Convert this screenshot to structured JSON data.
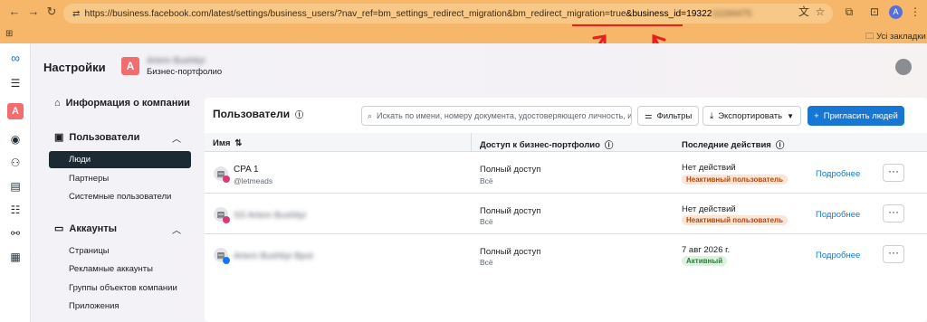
{
  "browser": {
    "url_prefix": "https://business.facebook.com/latest/settings/business_users/?nav_ref=bm_settings_redirect_migration&bm_redirect_migration=true",
    "url_highlight": "&business_id=19322",
    "url_blurred": "11194475",
    "bookmarks_label": "Усі закладки",
    "profile_letter": "A"
  },
  "header": {
    "title": "Настройки",
    "business_logo_letter": "A",
    "business_name": "Artem Bushtiyi",
    "business_subtitle": "Бизнес-портфолио"
  },
  "sidebar": {
    "company_info": "Информация о компании",
    "users_section": "Пользователи",
    "users_items": [
      "Люди",
      "Партнеры",
      "Системные пользователи"
    ],
    "accounts_section": "Аккаунты",
    "accounts_items": [
      "Страницы",
      "Рекламные аккаунты",
      "Группы объектов компании",
      "Приложения"
    ]
  },
  "panel": {
    "title": "Пользователи",
    "search_placeholder": "Искать по имени, номеру документа, удостоверяющего личность, и",
    "filters_button": "Фильтры",
    "export_button": "Экспортировать",
    "invite_button": "Пригласить людей",
    "columns": [
      "Имя",
      "Доступ к бизнес-портфолио",
      "Последние действия"
    ]
  },
  "rows": [
    {
      "name": "CPA 1",
      "sub": "@letmeads",
      "access": "Полный доступ",
      "access_sub": "Всё",
      "last_action": "Нет действий",
      "badge": "Неактивный пользователь",
      "details": "Подробнее",
      "blurred": false
    },
    {
      "name": "SS Artem Bushtiyi",
      "sub": "",
      "access": "Полный доступ",
      "access_sub": "Всё",
      "last_action": "Нет действий",
      "badge": "Неактивный пользователь",
      "details": "Подробнее",
      "blurred": true
    },
    {
      "name": "Artem Bushtiyi Bpot",
      "sub": "",
      "access": "Полный доступ",
      "access_sub": "Всё",
      "last_action": "7 авг 2026 г.",
      "badge": "Активный",
      "details": "Подробнее",
      "blurred": true
    }
  ],
  "colors": {
    "browser_bar": "#f6b76a",
    "accent_blue": "#1877d2",
    "brand_red": "#f26d6d",
    "annotation_red": "#e81d1d"
  }
}
